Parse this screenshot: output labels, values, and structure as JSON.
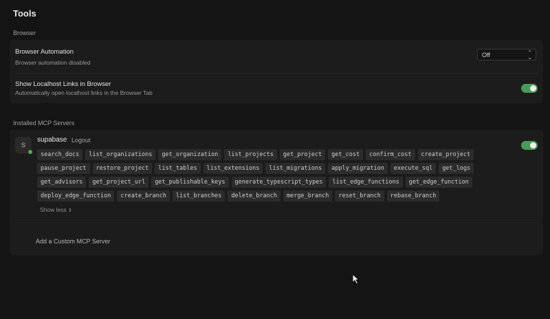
{
  "page": {
    "title": "Tools"
  },
  "browser": {
    "section_label": "Browser",
    "automation": {
      "title": "Browser Automation",
      "subtitle": "Browser automation disabled",
      "select_value": "Off"
    },
    "localhost": {
      "title": "Show Localhost Links in Browser",
      "subtitle": "Automatically open localhost links in the Browser Tab",
      "enabled": true
    }
  },
  "mcp": {
    "section_label": "Installed MCP Servers",
    "server": {
      "avatar_letter": "S",
      "name": "supabase",
      "logout_label": "Logout",
      "enabled": true,
      "tool_rows": [
        [
          "search_docs",
          "list_organizations",
          "get_organization",
          "list_projects",
          "get_project",
          "get_cost",
          "confirm_cost",
          "create_project"
        ],
        [
          "pause_project",
          "restore_project",
          "list_tables",
          "list_extensions",
          "list_migrations",
          "apply_migration",
          "execute_sql",
          "get_logs"
        ],
        [
          "get_advisors",
          "get_project_url",
          "get_publishable_keys",
          "generate_typescript_types",
          "list_edge_functions",
          "get_edge_function"
        ],
        [
          "deploy_edge_function",
          "create_branch",
          "list_branches",
          "delete_branch",
          "merge_branch",
          "reset_branch",
          "rebase_branch"
        ]
      ],
      "show_less_label": "Show less"
    },
    "add_server_label": "Add a Custom MCP Server"
  },
  "colors": {
    "toggle_on": "#4a9a5a",
    "status_dot": "#4caf50",
    "background": "#141414",
    "card": "#1c1c1c"
  },
  "icons": {
    "select_chevrons": "chevron-up-down-icon",
    "show_less": "chevron-up-down-icon",
    "cursor": "mouse-pointer-icon"
  }
}
